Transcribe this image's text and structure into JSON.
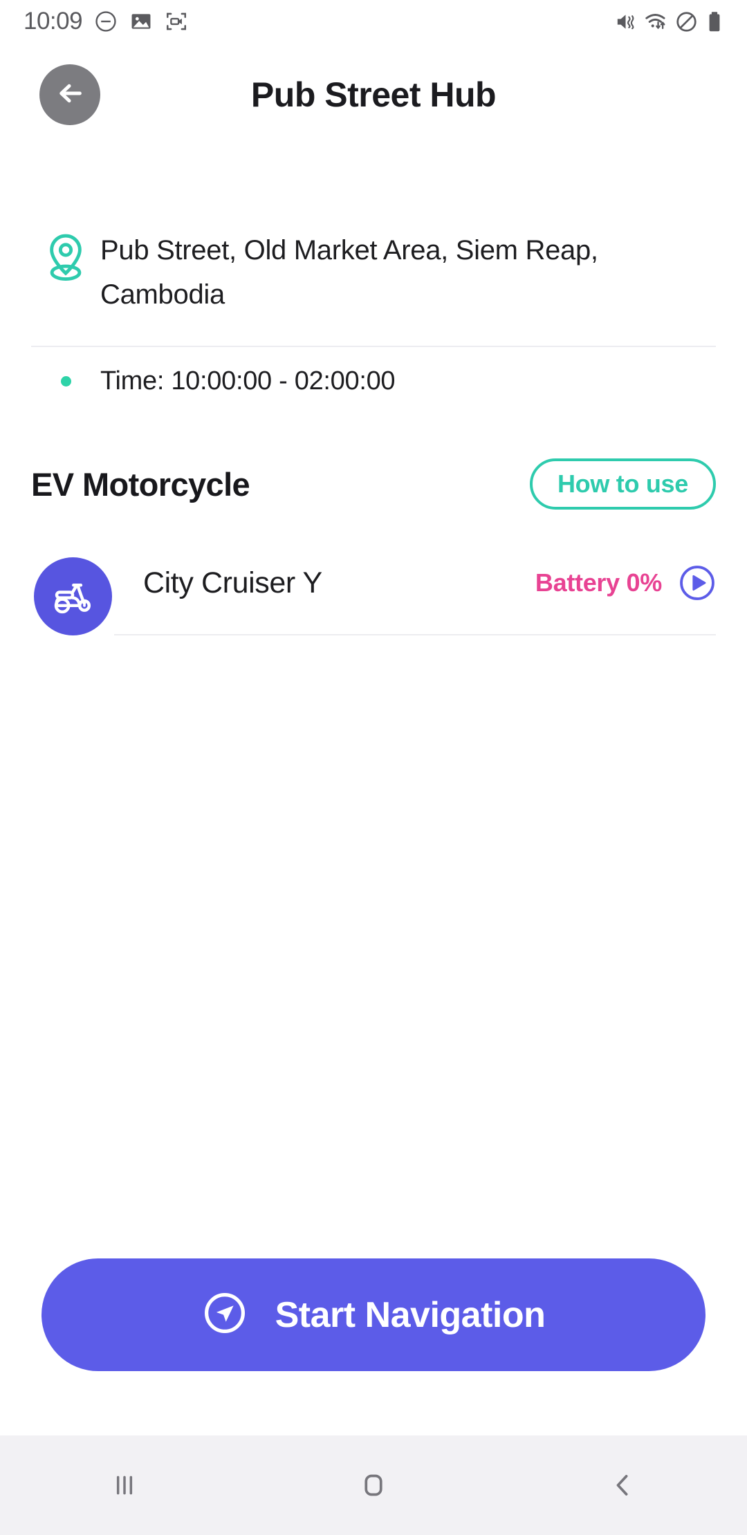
{
  "status_bar": {
    "clock": "10:09",
    "left_icons": [
      "dnd-minus-icon",
      "gallery-image-icon",
      "screen-recorder-icon"
    ],
    "right_icons": [
      "mute-vibrate-icon",
      "wifi-icon",
      "blocked-circle-icon",
      "battery-icon"
    ]
  },
  "header": {
    "back_icon": "arrow-left-icon",
    "title": "Pub Street Hub"
  },
  "location": {
    "pin_icon": "location-pin-icon",
    "address": "Pub Street, Old Market Area, Siem Reap, Cambodia",
    "time_label": "Time: 10:00:00 - 02:00:00"
  },
  "section": {
    "title": "EV Motorcycle",
    "how_to_use_label": "How to use"
  },
  "vehicles": [
    {
      "icon": "scooter-icon",
      "name": "City Cruiser Y",
      "battery": "Battery 0%",
      "play_icon": "play-circle-icon"
    }
  ],
  "cta": {
    "icon": "navigation-arrow-icon",
    "label": "Start Navigation"
  },
  "system_nav": {
    "recents_label": "recents-icon",
    "home_label": "home-icon",
    "back_label": "back-chevron-icon"
  },
  "colors": {
    "accent_teal": "#2ecbad",
    "accent_indigo": "#5c5ce8",
    "accent_pink": "#e84393",
    "text_dark": "#1d1d20",
    "divider": "#ececf0",
    "nav_bg": "#f2f1f4"
  }
}
